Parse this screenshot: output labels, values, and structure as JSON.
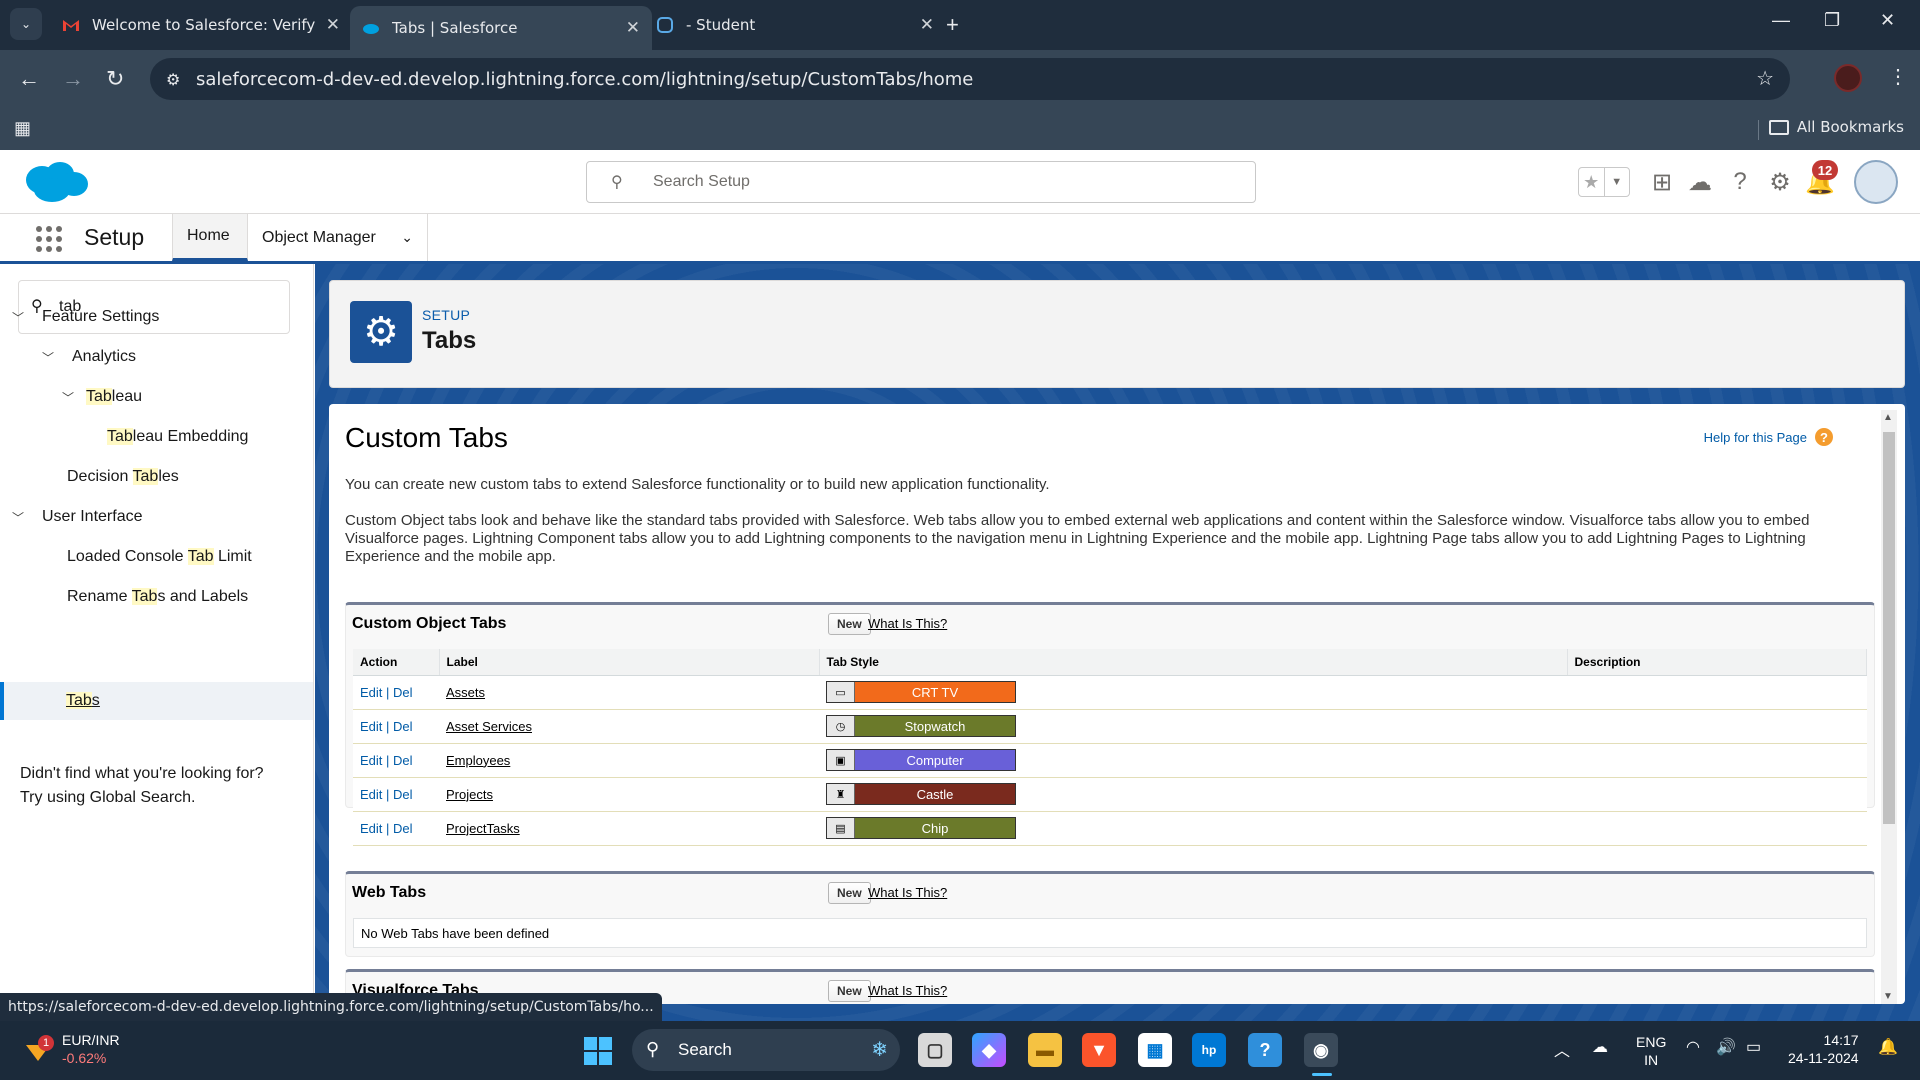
{
  "browser": {
    "tabs": [
      {
        "title": "Welcome to Salesforce: Verify y",
        "icon": "gmail-icon"
      },
      {
        "title": "Tabs | Salesforce",
        "icon": "salesforce-cloud-icon"
      },
      {
        "title": "- Student",
        "icon": "trailhead-icon"
      }
    ],
    "url": "saleforcecom-d-dev-ed.develop.lightning.force.com/lightning/setup/CustomTabs/home",
    "all_bookmarks": "All Bookmarks",
    "status_url": "https://saleforcecom-d-dev-ed.develop.lightning.force.com/lightning/setup/CustomTabs/ho..."
  },
  "sf_header": {
    "search_placeholder": "Search Setup",
    "notification_count": "12"
  },
  "sf_nav": {
    "app_name": "Setup",
    "home": "Home",
    "object_manager": "Object Manager"
  },
  "sidebar": {
    "quick_find_value": "tab",
    "items": [
      {
        "pre": "",
        "hl": "",
        "post": "Feature Settings"
      },
      {
        "pre": "",
        "hl": "",
        "post": "Analytics"
      },
      {
        "pre": "",
        "hl": "Tab",
        "post": "leau"
      },
      {
        "pre": "",
        "hl": "Tab",
        "post": "leau Embedding"
      },
      {
        "pre": "Decision ",
        "hl": "Tab",
        "post": "les"
      },
      {
        "pre": "",
        "hl": "",
        "post": "User Interface"
      },
      {
        "pre": "Loaded Console ",
        "hl": "Tab",
        "post": " Limit"
      },
      {
        "pre": "Rename ",
        "hl": "Tab",
        "post": "s and Labels"
      },
      {
        "pre": "",
        "hl": "Tab",
        "post": "s"
      }
    ],
    "not_found_line1": "Didn't find what you're looking for?",
    "not_found_line2": "Try using Global Search."
  },
  "page_header": {
    "eyebrow": "SETUP",
    "title": "Tabs"
  },
  "content": {
    "title": "Custom Tabs",
    "help_link": "Help for this Page",
    "intro": "You can create new custom tabs to extend Salesforce functionality or to build new application functionality.",
    "description": "Custom Object tabs look and behave like the standard tabs provided with Salesforce. Web tabs allow you to embed external web applications and content within the Salesforce window. Visualforce tabs allow you to embed Visualforce pages. Lightning Component tabs allow you to add Lightning components to the navigation menu in Lightning Experience and the mobile app. Lightning Page tabs allow you to add Lightning Pages to Lightning Experience and the mobile app.",
    "new_label": "New",
    "what_is_this": "What Is This?",
    "custom_object_tabs": {
      "title": "Custom Object Tabs",
      "columns": [
        "Action",
        "Label",
        "Tab Style",
        "Description"
      ],
      "edit": "Edit",
      "sep": " | ",
      "del": "Del",
      "rows": [
        {
          "label": "Assets",
          "style": "CRT TV",
          "color": "#f26a1b"
        },
        {
          "label": "Asset Services",
          "style": "Stopwatch",
          "color": "#6b7a2a"
        },
        {
          "label": "Employees",
          "style": "Computer",
          "color": "#6960d8"
        },
        {
          "label": "Projects",
          "style": "Castle",
          "color": "#7a2a1e"
        },
        {
          "label": "ProjectTasks",
          "style": "Chip",
          "color": "#6b7a2a"
        }
      ]
    },
    "web_tabs": {
      "title": "Web Tabs",
      "empty": "No Web Tabs have been defined"
    },
    "visualforce_tabs": {
      "title": "Visualforce Tabs"
    }
  },
  "taskbar": {
    "ticker_name": "EUR/INR",
    "ticker_change": "-0.62%",
    "ticker_badge": "1",
    "search": "Search",
    "lang1": "ENG",
    "lang2": "IN",
    "time": "14:17",
    "date": "24-11-2024"
  }
}
